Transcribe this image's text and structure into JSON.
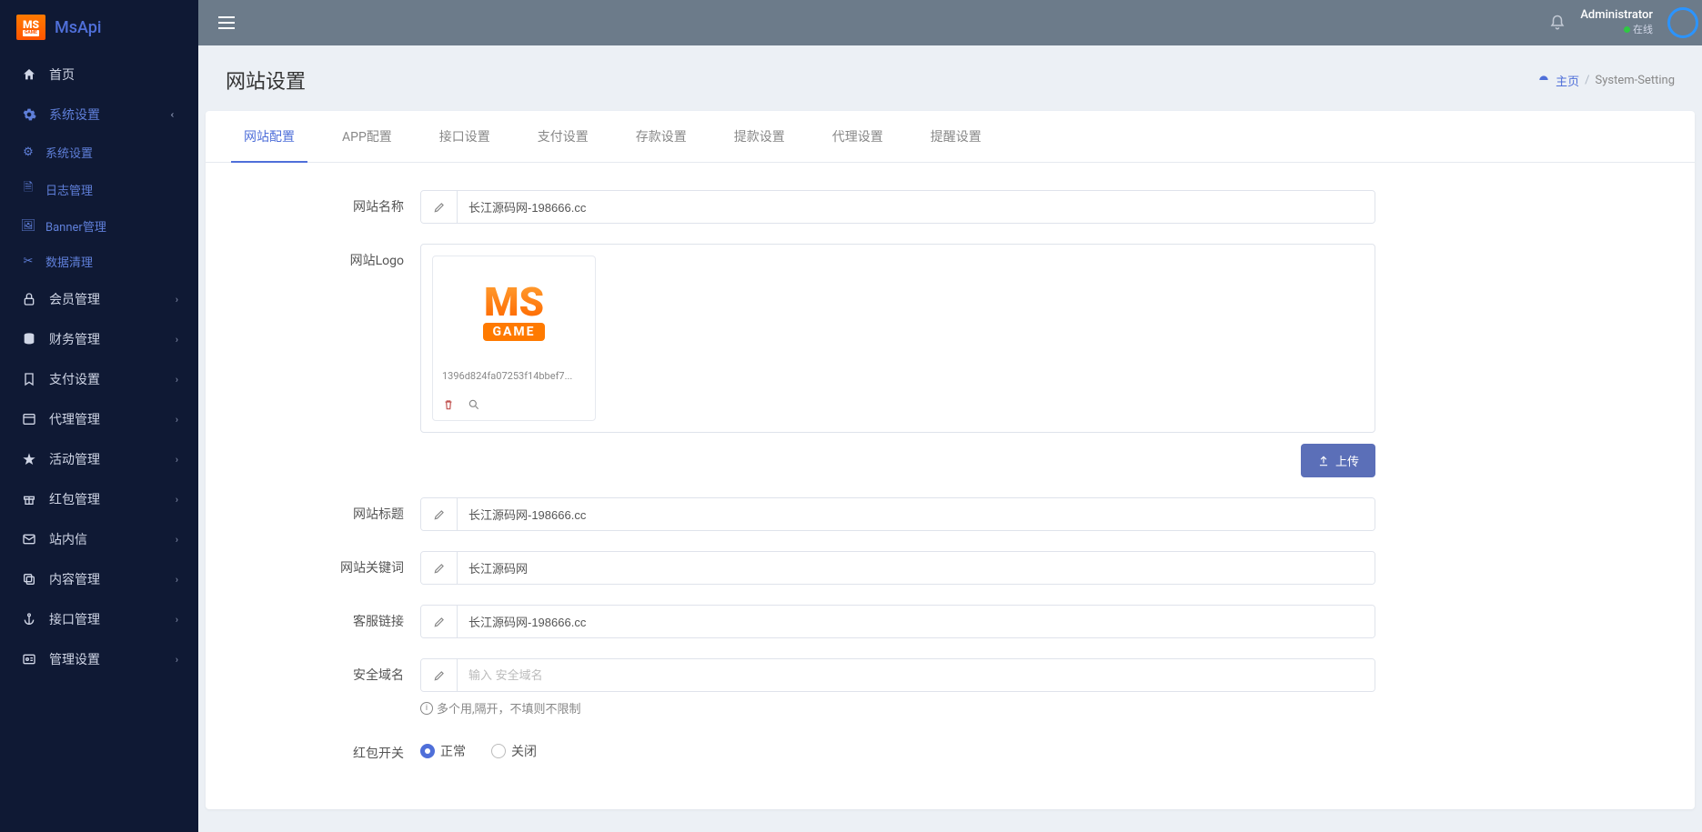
{
  "brand": "MsApi",
  "sidebar": {
    "home": "首页",
    "system": "系统设置",
    "system_children": {
      "settings": "系统设置",
      "logs": "日志管理",
      "banner": "Banner管理",
      "cleanup": "数据清理"
    },
    "member": "会员管理",
    "finance": "财务管理",
    "payment": "支付设置",
    "agent": "代理管理",
    "activity": "活动管理",
    "redpacket": "红包管理",
    "message": "站内信",
    "content": "内容管理",
    "api": "接口管理",
    "admin": "管理设置"
  },
  "topbar": {
    "user": "Administrator",
    "status": "在线"
  },
  "page": {
    "title": "网站设置",
    "breadcrumb_home": "主页",
    "breadcrumb_current": "System-Setting"
  },
  "tabs": [
    "网站配置",
    "APP配置",
    "接口设置",
    "支付设置",
    "存款设置",
    "提款设置",
    "代理设置",
    "提醒设置"
  ],
  "form": {
    "site_name_label": "网站名称",
    "site_name_value": "长江源码网-198666.cc",
    "site_logo_label": "网站Logo",
    "logo_filename": "1396d824fa07253f14bbef7...",
    "upload_btn": "上传",
    "site_title_label": "网站标题",
    "site_title_value": "长江源码网-198666.cc",
    "site_keywords_label": "网站关键词",
    "site_keywords_value": "长江源码网",
    "service_link_label": "客服链接",
    "service_link_value": "长江源码网-198666.cc",
    "safe_domain_label": "安全域名",
    "safe_domain_placeholder": "输入 安全域名",
    "safe_domain_help": "多个用,隔开，不填则不限制",
    "redpacket_switch_label": "红包开关",
    "radio_normal": "正常",
    "radio_closed": "关闭"
  }
}
